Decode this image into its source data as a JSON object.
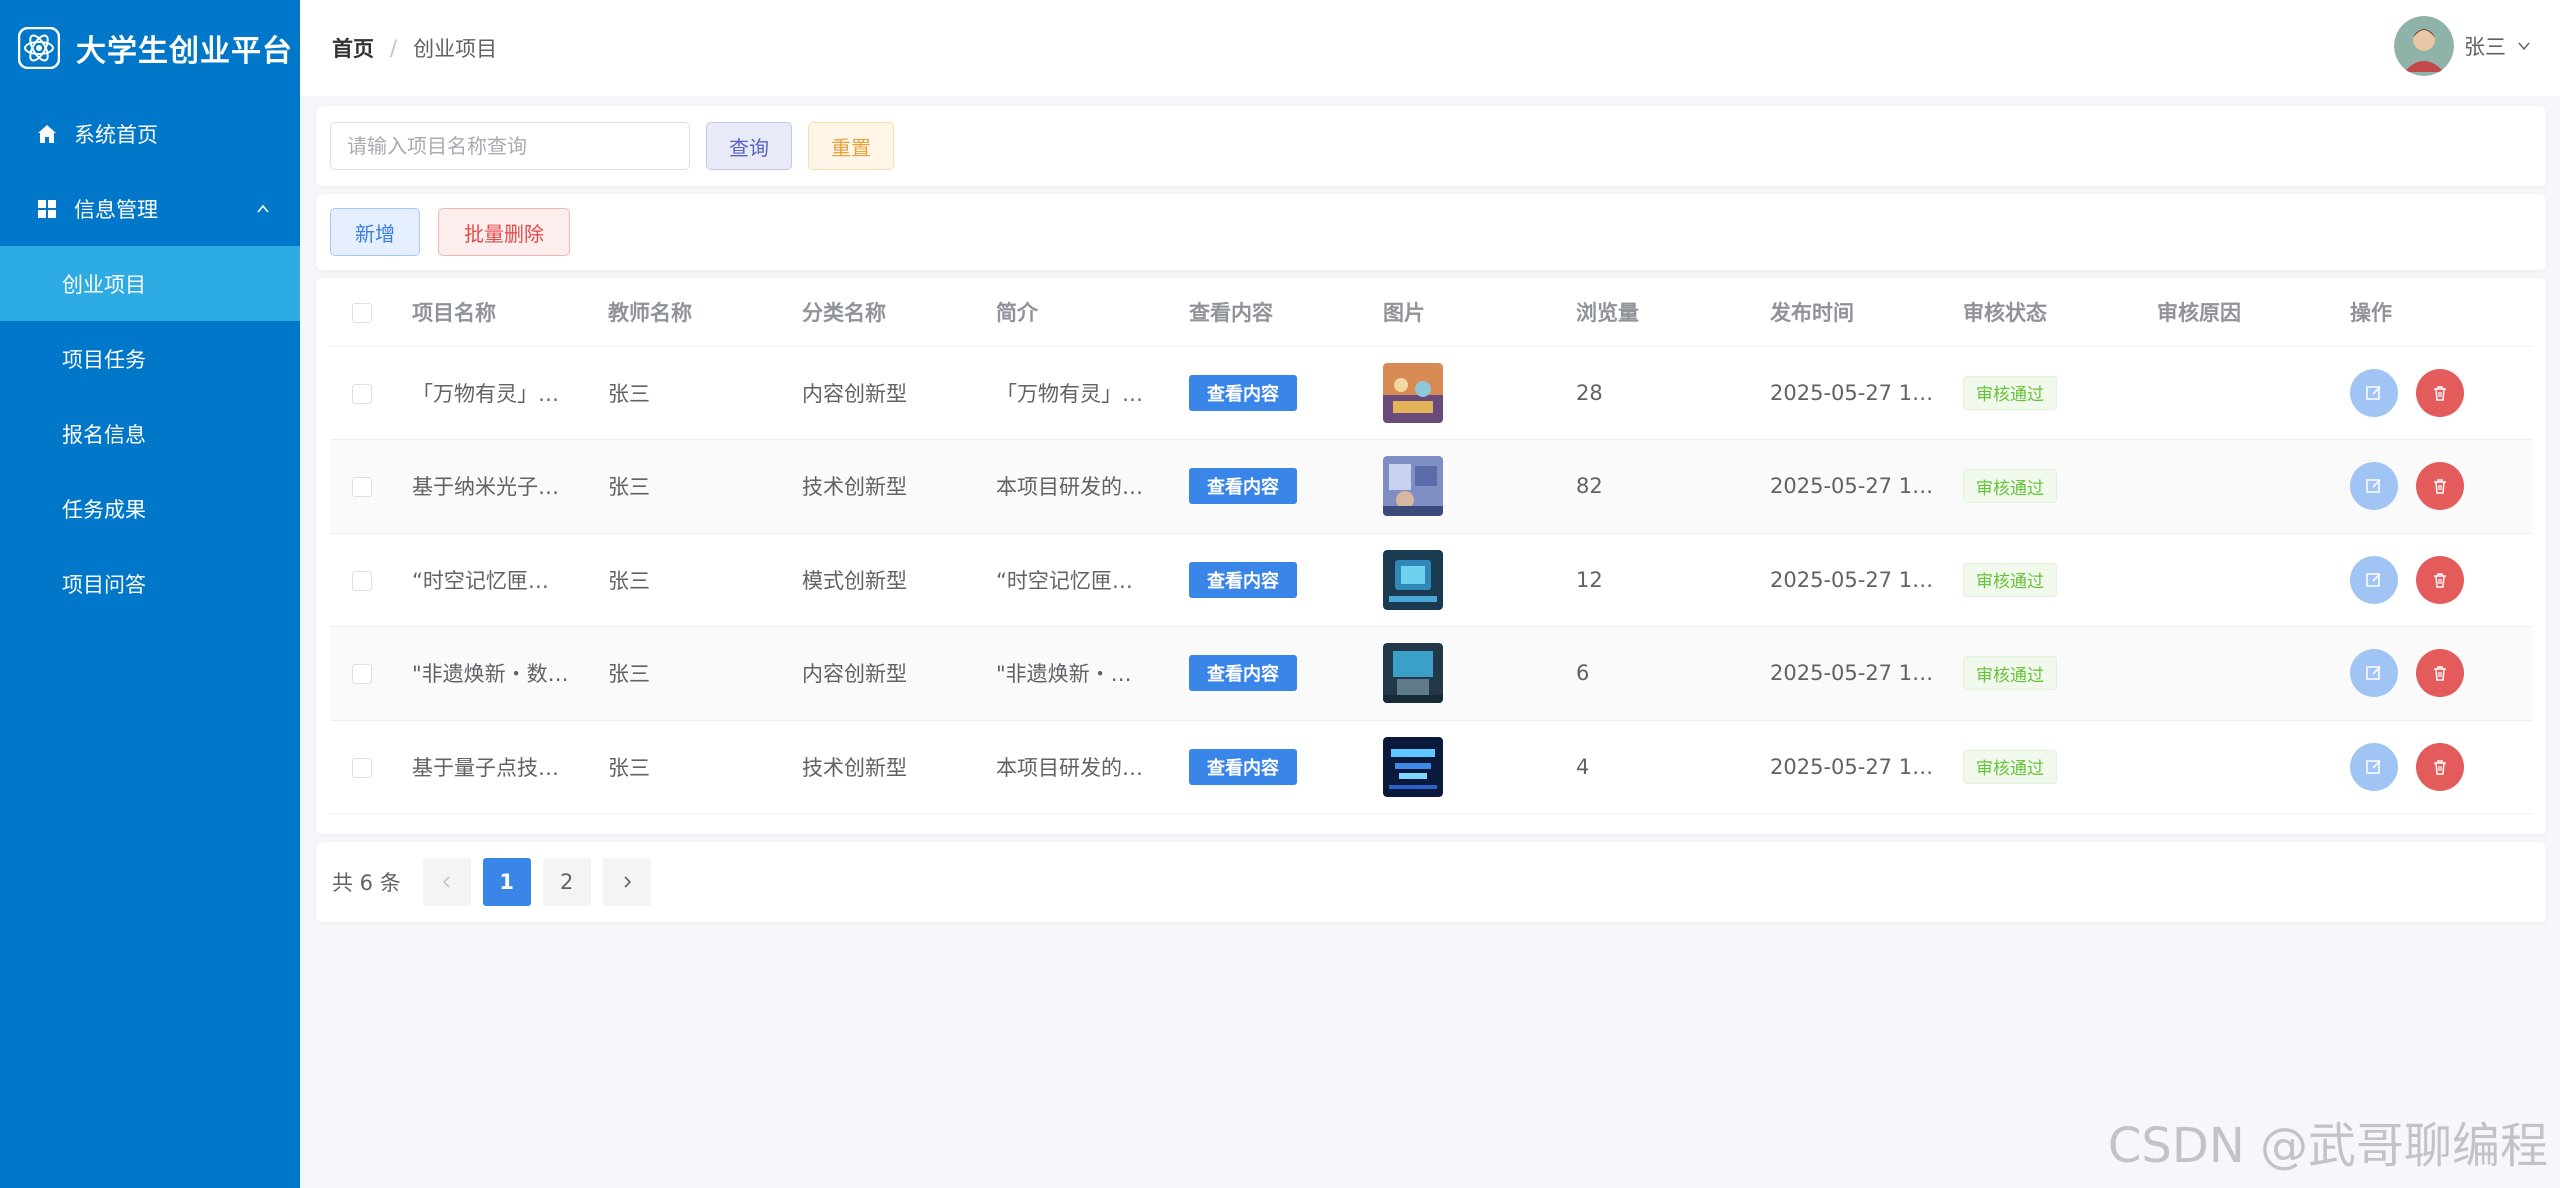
{
  "app": {
    "title": "大学生创业平台"
  },
  "sidebar": {
    "items": [
      {
        "label": "系统首页"
      },
      {
        "label": "信息管理"
      }
    ],
    "sub_items": [
      {
        "label": "创业项目",
        "active": true
      },
      {
        "label": "项目任务"
      },
      {
        "label": "报名信息"
      },
      {
        "label": "任务成果"
      },
      {
        "label": "项目问答"
      }
    ]
  },
  "header": {
    "breadcrumb_home": "首页",
    "breadcrumb_sep": "/",
    "breadcrumb_current": "创业项目",
    "user_name": "张三"
  },
  "search": {
    "placeholder": "请输入项目名称查询",
    "query_label": "查询",
    "reset_label": "重置"
  },
  "actions": {
    "add_label": "新增",
    "batch_delete_label": "批量删除"
  },
  "table": {
    "columns": [
      "项目名称",
      "教师名称",
      "分类名称",
      "简介",
      "查看内容",
      "图片",
      "浏览量",
      "发布时间",
      "审核状态",
      "审核原因",
      "操作"
    ],
    "view_label": "查看内容",
    "rows": [
      {
        "name": "「万物有灵」…",
        "teacher": "张三",
        "category": "内容创新型",
        "intro": "「万物有灵」…",
        "views": "28",
        "time": "2025-05-27 1…",
        "status": "审核通过",
        "reason": ""
      },
      {
        "name": "基于纳米光子…",
        "teacher": "张三",
        "category": "技术创新型",
        "intro": "本项目研发的…",
        "views": "82",
        "time": "2025-05-27 1…",
        "status": "审核通过",
        "reason": ""
      },
      {
        "name": "“时空记忆匣…",
        "teacher": "张三",
        "category": "模式创新型",
        "intro": "“时空记忆匣…",
        "views": "12",
        "time": "2025-05-27 1…",
        "status": "审核通过",
        "reason": ""
      },
      {
        "name": "\"非遗焕新・数…",
        "teacher": "张三",
        "category": "内容创新型",
        "intro": "\"非遗焕新・…",
        "views": "6",
        "time": "2025-05-27 1…",
        "status": "审核通过",
        "reason": ""
      },
      {
        "name": "基于量子点技…",
        "teacher": "张三",
        "category": "技术创新型",
        "intro": "本项目研发的…",
        "views": "4",
        "time": "2025-05-27 1…",
        "status": "审核通过",
        "reason": ""
      }
    ]
  },
  "pagination": {
    "total_label": "共 6 条",
    "pages": [
      "1",
      "2"
    ],
    "current": "1"
  },
  "watermark": "CSDN @武哥聊编程",
  "colors": {
    "sidebar": "#0077c8",
    "sidebar_active": "#2dabe3",
    "primary": "#3a85e8",
    "danger": "#e35b5b",
    "success": "#67c23a"
  }
}
